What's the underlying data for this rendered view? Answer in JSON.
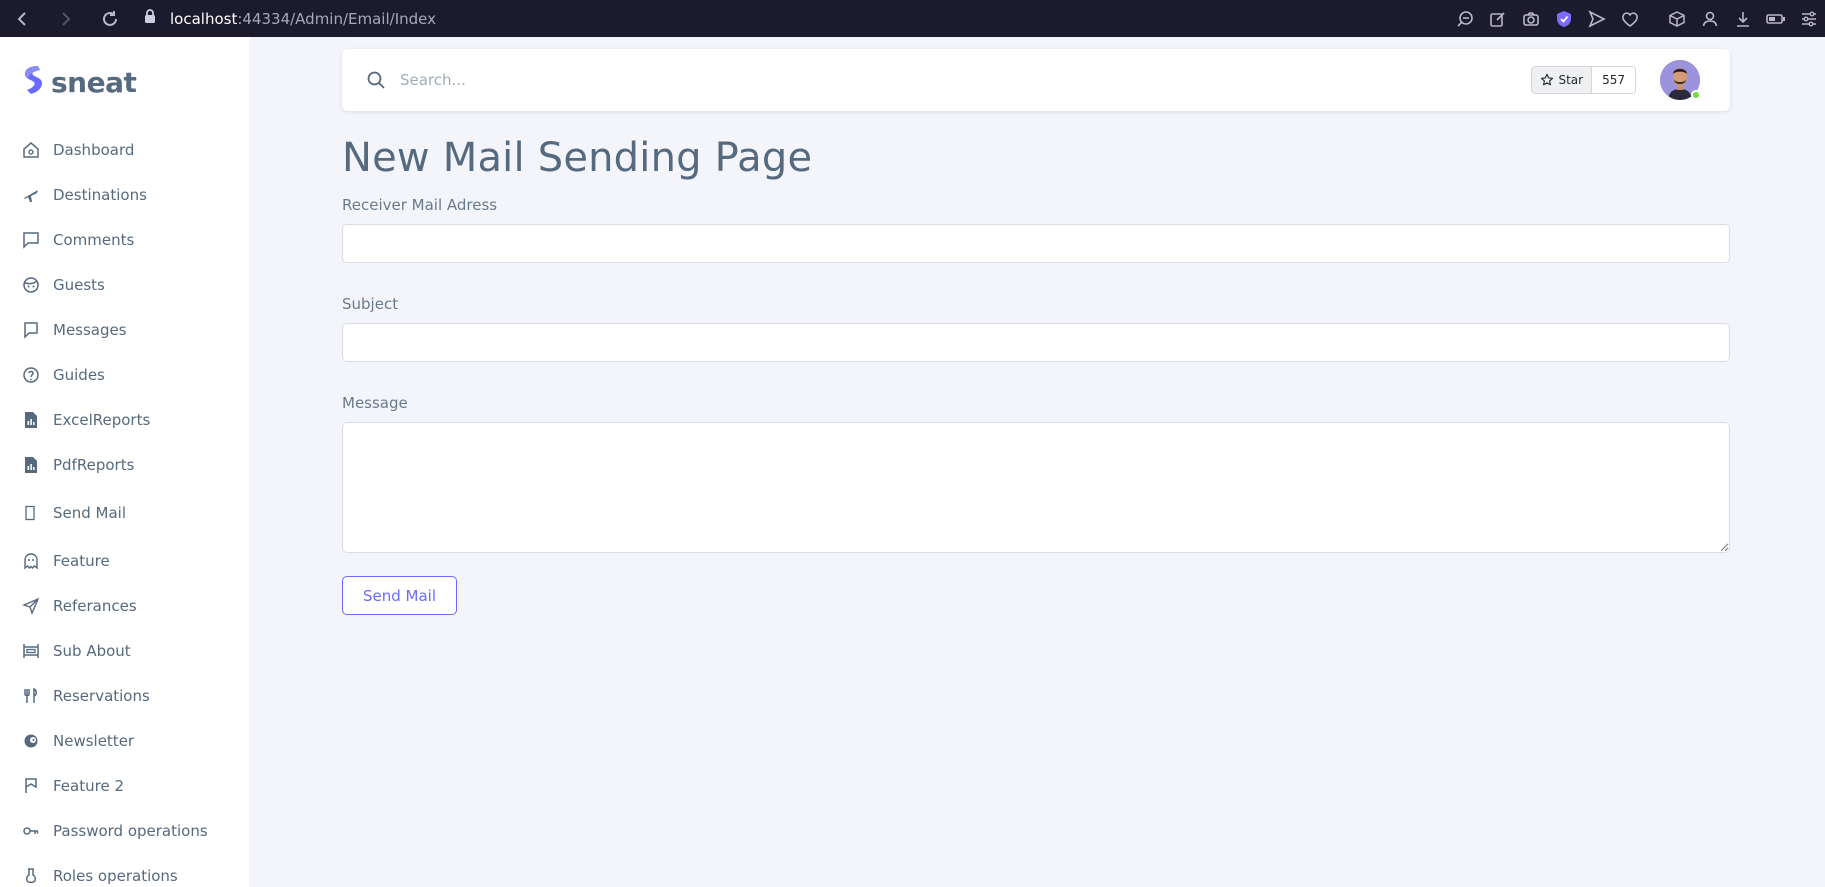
{
  "browser": {
    "url_host": "localhost",
    "url_path": ":44334/Admin/Email/Index"
  },
  "sidebar": {
    "brand": "sneat",
    "items": [
      {
        "label": "Dashboard",
        "icon": "home-icon"
      },
      {
        "label": "Destinations",
        "icon": "plane-icon"
      },
      {
        "label": "Comments",
        "icon": "comment-icon"
      },
      {
        "label": "Guests",
        "icon": "face-icon"
      },
      {
        "label": "Messages",
        "icon": "message-icon"
      },
      {
        "label": "Guides",
        "icon": "help-circle-icon"
      },
      {
        "label": "ExcelReports",
        "icon": "file-chart-icon"
      },
      {
        "label": "PdfReports",
        "icon": "file-chart-icon"
      },
      {
        "label": "Send Mail",
        "icon": "blank-icon"
      },
      {
        "label": "Feature",
        "icon": "ghost-icon"
      },
      {
        "label": "Referances",
        "icon": "send-icon"
      },
      {
        "label": "Sub About",
        "icon": "layout-icon"
      },
      {
        "label": "Reservations",
        "icon": "restaurant-icon"
      },
      {
        "label": "Newsletter",
        "icon": "mailchimp-icon"
      },
      {
        "label": "Feature 2",
        "icon": "bookmark-icon"
      },
      {
        "label": "Password operations",
        "icon": "key-icon"
      },
      {
        "label": "Roles operations",
        "icon": "flask-icon"
      }
    ]
  },
  "navbar": {
    "search_placeholder": "Search...",
    "star_label": "Star",
    "star_count": "557"
  },
  "page": {
    "title": "New Mail Sending Page",
    "receiver_label": "Receiver Mail Adress",
    "receiver_value": "",
    "subject_label": "Subject",
    "subject_value": "",
    "message_label": "Message",
    "message_value": "",
    "send_button": "Send Mail"
  },
  "colors": {
    "primary": "#696cff",
    "text": "#566a7f",
    "background": "#f4f5fa"
  }
}
